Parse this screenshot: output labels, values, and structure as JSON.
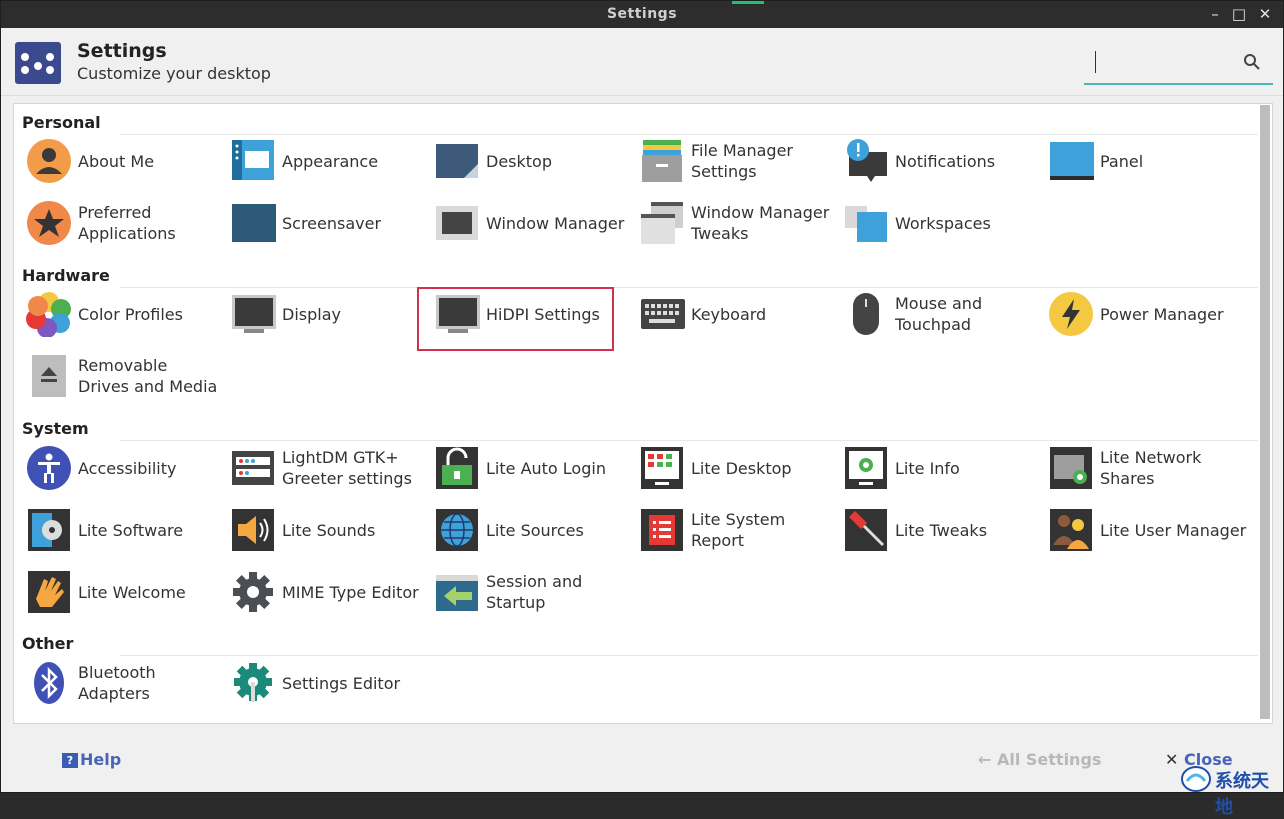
{
  "window": {
    "title": "Settings",
    "controls": [
      "–",
      "□",
      "✕"
    ]
  },
  "header": {
    "title": "Settings",
    "subtitle": "Customize your desktop",
    "search_placeholder": ""
  },
  "sections": {
    "personal": "Personal",
    "hardware": "Hardware",
    "system": "System",
    "other": "Other"
  },
  "items": {
    "about_me": "About Me",
    "appearance": "Appearance",
    "desktop": "Desktop",
    "file_manager_1": "File Manager",
    "file_manager_2": "Settings",
    "notifications": "Notifications",
    "panel": "Panel",
    "preferred_1": "Preferred",
    "preferred_2": "Applications",
    "screensaver": "Screensaver",
    "window_manager": "Window Manager",
    "wm_tweaks_1": "Window Manager",
    "wm_tweaks_2": "Tweaks",
    "workspaces": "Workspaces",
    "color_profiles": "Color Profiles",
    "display": "Display",
    "hidpi": "HiDPI Settings",
    "keyboard": "Keyboard",
    "mouse_1": "Mouse and",
    "mouse_2": "Touchpad",
    "power_manager": "Power Manager",
    "removable_1": "Removable",
    "removable_2": "Drives and Media",
    "accessibility": "Accessibility",
    "lightdm_1": "LightDM GTK+",
    "lightdm_2": "Greeter settings",
    "lite_auto_login": "Lite Auto Login",
    "lite_desktop": "Lite Desktop",
    "lite_info": "Lite Info",
    "lite_network_1": "Lite Network",
    "lite_network_2": "Shares",
    "lite_software": "Lite Software",
    "lite_sounds": "Lite Sounds",
    "lite_sources": "Lite Sources",
    "lite_sysreport_1": "Lite System",
    "lite_sysreport_2": "Report",
    "lite_tweaks": "Lite Tweaks",
    "lite_user_manager": "Lite User Manager",
    "lite_welcome": "Lite Welcome",
    "mime_editor": "MIME Type Editor",
    "session_1": "Session and",
    "session_2": "Startup",
    "bluetooth_1": "Bluetooth",
    "bluetooth_2": "Adapters",
    "settings_editor": "Settings Editor"
  },
  "footer": {
    "help_icon": "?",
    "help": "Help",
    "all_settings": "← All Settings",
    "close_x": "✕",
    "close": "Close"
  },
  "watermark": "系统天地",
  "colors": {
    "accent": "#4db6b6",
    "highlight": "#d0324a",
    "link": "#4a63b8"
  }
}
